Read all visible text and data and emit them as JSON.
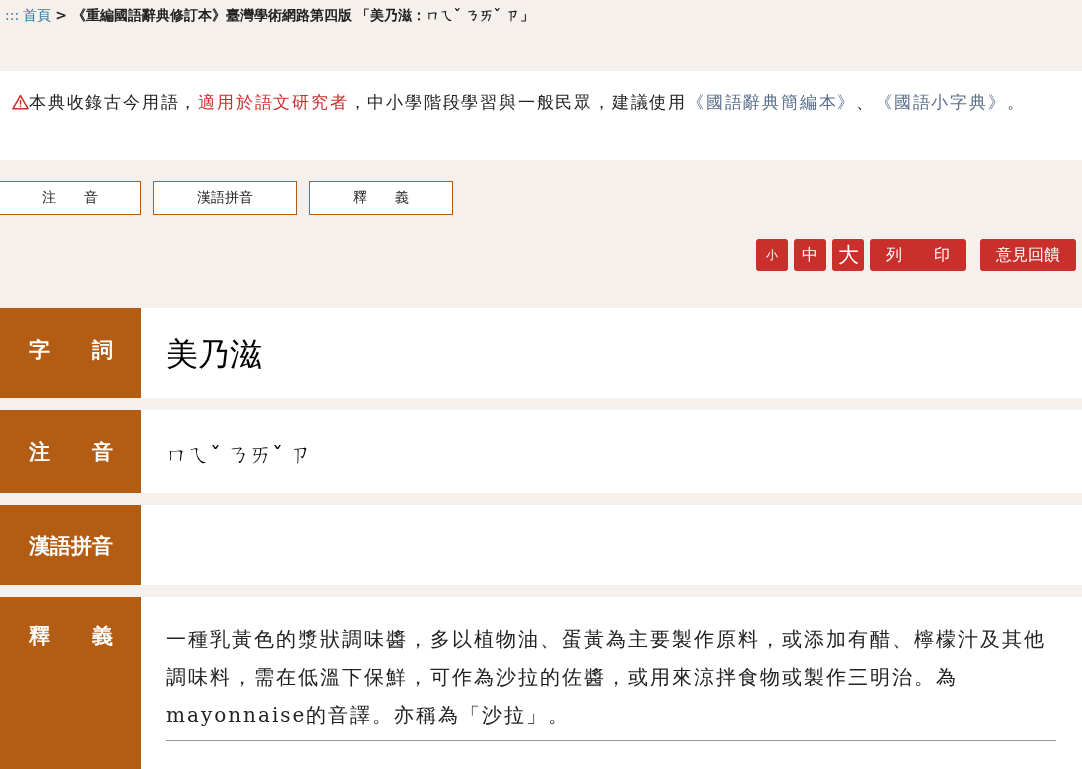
{
  "breadcrumb": {
    "prefix": ":::",
    "home": "首頁",
    "trail": "> 《重編國語辭典修訂本》臺灣學術網路第四版",
    "entry": "「美乃滋：ㄇㄟˇ ㄋㄞˇ ㄗ」"
  },
  "notice": {
    "segments": [
      {
        "kind": "plain",
        "text": "本典收錄古今用語，"
      },
      {
        "kind": "highlight",
        "text": "適用於語文研究者"
      },
      {
        "kind": "plain",
        "text": "，中小學階段學習與一般民眾，建議使用"
      },
      {
        "kind": "link",
        "text": "《國語辭典簡編本》"
      },
      {
        "kind": "plain",
        "text": "、"
      },
      {
        "kind": "link",
        "text": "《國語小字典》"
      },
      {
        "kind": "plain",
        "text": "。"
      }
    ]
  },
  "tabs": [
    {
      "label": "注　　音"
    },
    {
      "label": "漢語拼音"
    },
    {
      "label": "釋　　義"
    }
  ],
  "tools": [
    {
      "kind": "size-small",
      "label": "小"
    },
    {
      "kind": "size-medium",
      "label": "中"
    },
    {
      "kind": "size-large",
      "label": "大"
    },
    {
      "kind": "print",
      "label": "列　　印"
    },
    {
      "kind": "feedback",
      "label": "意見回饋"
    }
  ],
  "fields": [
    {
      "kind": "word",
      "label": "字　　詞",
      "value": "美乃滋"
    },
    {
      "kind": "zhuyin",
      "label": "注　　音",
      "value": "ㄇㄟˇ ㄋㄞˇ ㄗ"
    },
    {
      "kind": "pinyin",
      "label": "漢語拼音"
    },
    {
      "kind": "definition",
      "label": "釋　　義",
      "value": "一種乳黃色的漿狀調味醬，多以植物油、蛋黃為主要製作原料，或添加有醋、檸檬汁及其他調味料，需在低溫下保鮮，可作為沙拉的佐醬，或用來涼拌食物或製作三明治。為mayonnaise的音譯。亦稱為「沙拉」。"
    }
  ]
}
